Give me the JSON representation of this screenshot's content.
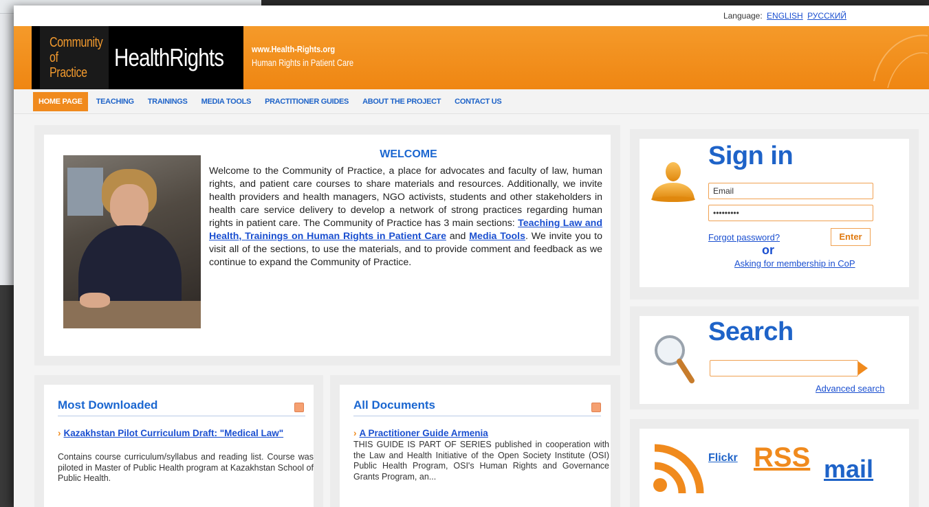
{
  "language_bar": {
    "label": "Language:",
    "options": [
      "ENGLISH",
      "РУССКИЙ"
    ]
  },
  "header": {
    "logo_line1": "Community",
    "logo_line2": "of Practice",
    "logo_brand": "HealthRights",
    "site_url": "www.Health-Rights.org",
    "tagline": "Human Rights in Patient Care"
  },
  "nav": {
    "items": [
      {
        "label": "HOME PAGE",
        "active": true
      },
      {
        "label": "TEACHING",
        "active": false
      },
      {
        "label": "TRAININGS",
        "active": false
      },
      {
        "label": "MEDIA TOOLS",
        "active": false
      },
      {
        "label": "PRACTITIONER GUIDES",
        "active": false
      },
      {
        "label": "ABOUT THE PROJECT",
        "active": false
      },
      {
        "label": "CONTACT US",
        "active": false
      }
    ]
  },
  "welcome": {
    "title": "WELCOME",
    "text_before": "Welcome to the Community of Practice, a place for advocates and faculty of law, human rights, and patient care courses to share materials and resources. Additionally, we invite health providers and health managers, NGO activists, students and other stakeholders in health care service delivery to develop a network of strong practices regarding human rights in patient care. The Community of Practice has 3 main sections: ",
    "link_teaching": "Teaching Law and Health",
    "link_trainings": "Trainings on Human Rights in Patient Care",
    "word_and": " and ",
    "link_media": "Media Tools",
    "text_after": ".  We invite you to visit all of the sections, to use the materials, and to provide comment and feedback as we continue to expand the Community of Practice."
  },
  "most_downloaded": {
    "title": "Most Downloaded",
    "item_title": "Kazakhstan Pilot Curriculum Draft: \"Medical Law\"",
    "item_desc": "Contains course curriculum/syllabus and reading list. Course was piloted in Master of Public Health program at Kazakhstan School of Public Health."
  },
  "all_documents": {
    "title": "All Documents",
    "item_title": "A Practitioner Guide Armenia",
    "item_desc": "THIS GUIDE IS PART OF SERIES published in cooperation with the Law and Health Initiative of the Open Society Institute (OSI) Public Health Program, OSI's Human Rights and Governance Grants Program, an..."
  },
  "signin": {
    "heading": "Sign in",
    "email_value": "Email",
    "password_value": "•••••••••",
    "forgot_label": "Forgot password?",
    "enter_label": "Enter",
    "or_label": "or",
    "membership_label": "Asking for membership in CoP"
  },
  "search": {
    "heading": "Search",
    "advanced_label": "Advanced search"
  },
  "social": {
    "flickr": "Flickr",
    "rss": "RSS",
    "mail": "mail"
  },
  "colors": {
    "brand_orange": "#f08a1d",
    "link_blue": "#1a4fd0",
    "heading_blue": "#1e63c8"
  },
  "icons": [
    "user-icon",
    "magnifier-icon",
    "rss-feed-icon",
    "rss-small-icon",
    "dropdown-arrow-icon"
  ]
}
